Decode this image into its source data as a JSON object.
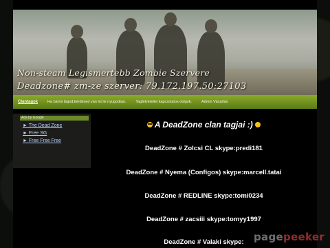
{
  "header": {
    "title_line1": "Non-steam Legismertebb Zombie Szervere",
    "title_line2": "Deadzone# zm-ze szerver:    79.172.197.50:27103"
  },
  "nav": {
    "items": [
      {
        "label": "Clantagok"
      },
      {
        "label": "Ha bármi bajod,kérdésed van írd le nyugodtan."
      },
      {
        "label": "Tagfelvétellel kapcsolatos dolgok."
      },
      {
        "label": "Admin Vásárlás"
      }
    ]
  },
  "sidebar": {
    "ads_label": "Ads by Google",
    "links": [
      {
        "label": "► The Dead Zone"
      },
      {
        "label": "► Free SG"
      },
      {
        "label": "► Free Free Free"
      }
    ]
  },
  "main": {
    "title": "A DeadZone clan tagjai :)",
    "members": [
      {
        "text": "DeadZone # Zolcsi CL skype:predi181"
      },
      {
        "text": "DeadZone # Nyema (Configos) skype:marcell.tatai"
      },
      {
        "text": "DeadZone # REDLINE skype:tomi0234"
      },
      {
        "text": "DeadZone # zacsiii skype:tomyy1997"
      },
      {
        "text": "DeadZone # Valaki skype:"
      }
    ]
  },
  "watermark": {
    "part1": "page",
    "part2": "peeker"
  },
  "colors": {
    "nav_green": "#6f8f1e",
    "link_blue": "#b9cfff",
    "emoji_yellow": "#f2c21b"
  }
}
